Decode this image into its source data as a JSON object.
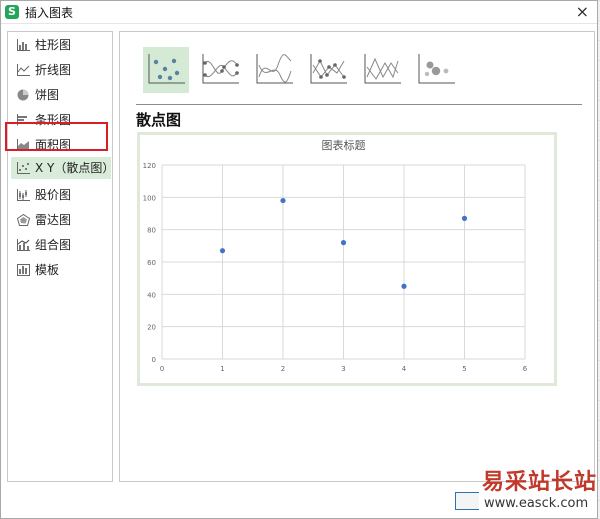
{
  "dialog": {
    "title": "插入图表",
    "app_icon_letter": "S"
  },
  "sidebar": {
    "items": [
      {
        "label": "柱形图",
        "icon": "column-chart-icon"
      },
      {
        "label": "折线图",
        "icon": "line-chart-icon"
      },
      {
        "label": "饼图",
        "icon": "pie-chart-icon"
      },
      {
        "label": "条形图",
        "icon": "bar-chart-icon"
      },
      {
        "label": "面积图",
        "icon": "area-chart-icon"
      },
      {
        "label": "X Y（散点图）",
        "icon": "scatter-chart-icon",
        "selected": true
      },
      {
        "label": "股价图",
        "icon": "stock-chart-icon"
      },
      {
        "label": "雷达图",
        "icon": "radar-chart-icon"
      },
      {
        "label": "组合图",
        "icon": "combo-chart-icon"
      },
      {
        "label": "模板",
        "icon": "template-icon"
      }
    ]
  },
  "subtypes": [
    {
      "name": "scatter-markers",
      "selected": true
    },
    {
      "name": "scatter-smooth-lines-markers"
    },
    {
      "name": "scatter-smooth-lines"
    },
    {
      "name": "scatter-straight-lines-markers"
    },
    {
      "name": "scatter-straight-lines"
    },
    {
      "name": "bubble"
    }
  ],
  "main": {
    "section_title": "散点图"
  },
  "chart_data": {
    "type": "scatter",
    "title": "图表标题",
    "x": [
      1,
      2,
      3,
      4,
      5
    ],
    "y": [
      67,
      98,
      72,
      45,
      87
    ],
    "xlim": [
      0,
      6
    ],
    "ylim": [
      0,
      120
    ],
    "x_ticks": [
      0,
      1,
      2,
      3,
      4,
      5,
      6
    ],
    "y_ticks": [
      0,
      20,
      40,
      60,
      80,
      100,
      120
    ],
    "grid": true,
    "marker_color": "#4472c4"
  },
  "watermark": {
    "line1": "易采站长站",
    "line2": "www.easck.com"
  },
  "colors": {
    "accent": "#d5ead4",
    "highlight_border": "#d81f26",
    "point": "#4472c4"
  }
}
